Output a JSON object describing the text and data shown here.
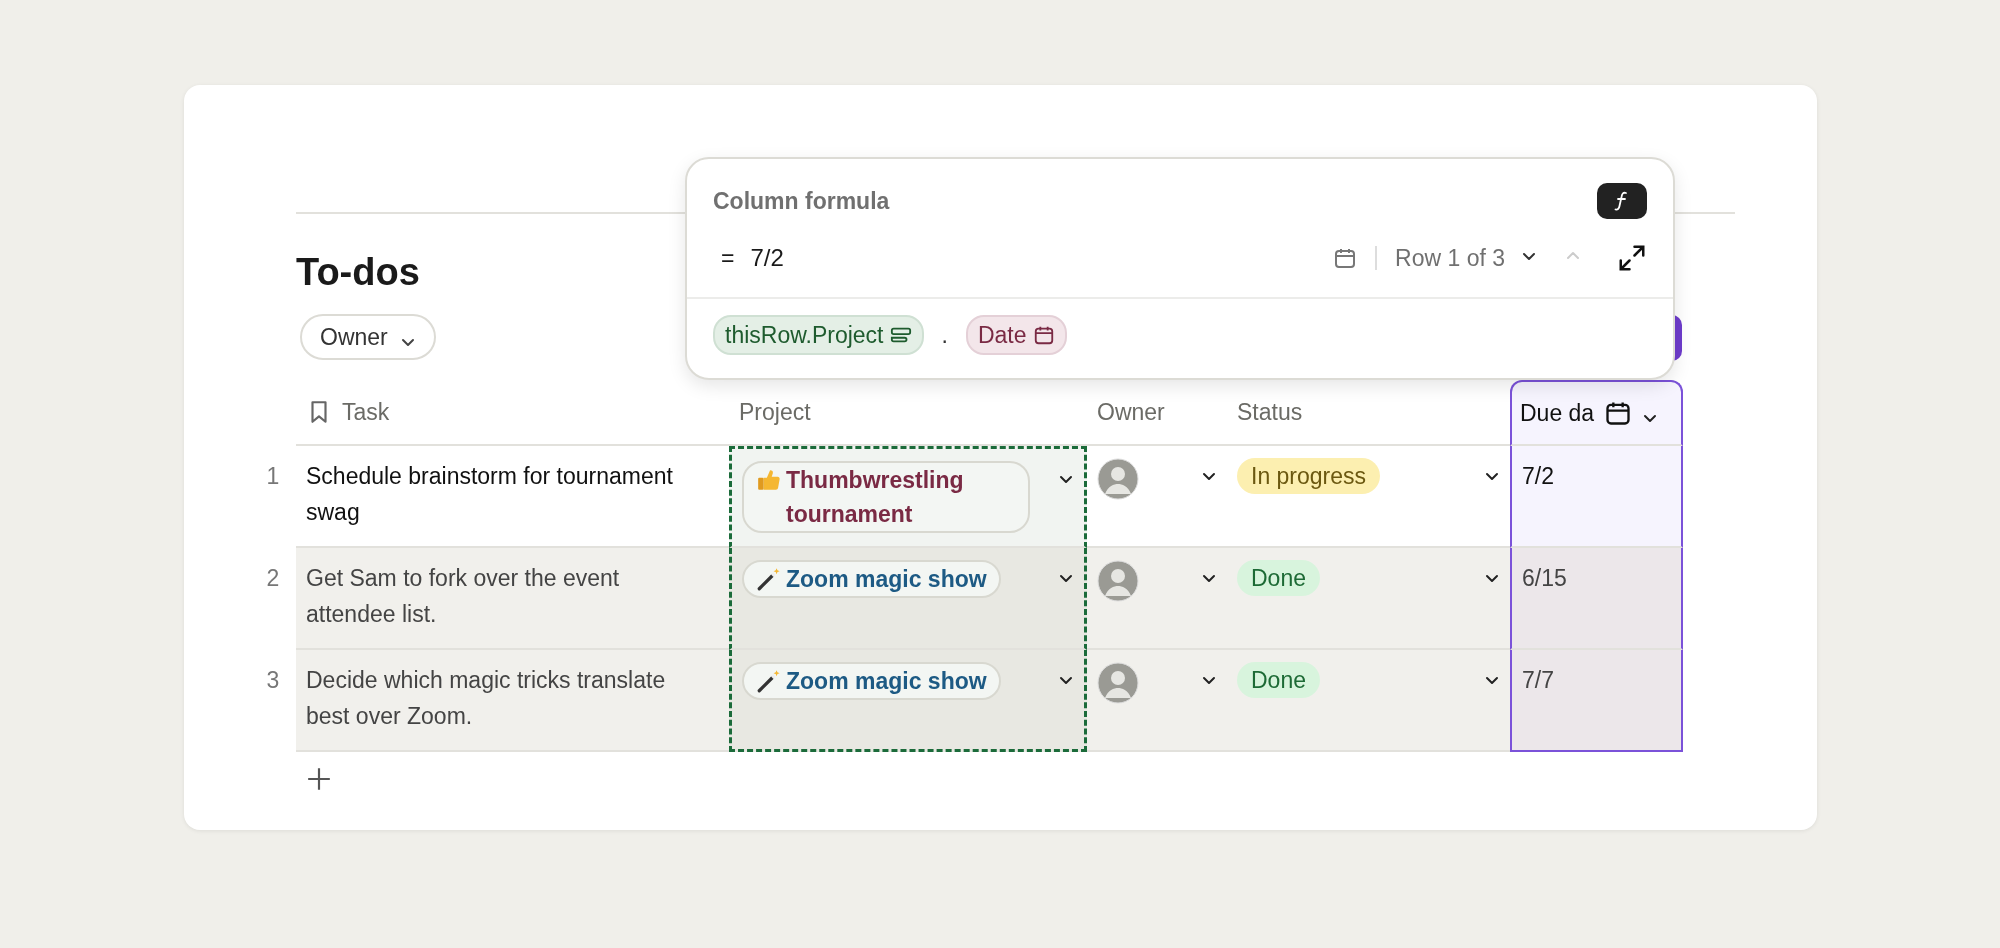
{
  "formula_popup": {
    "title": "Column formula",
    "equals": "=",
    "result": "7/2",
    "row_indicator": "Row 1 of 3",
    "prev_disabled": true,
    "next_disabled": false,
    "tokens": [
      {
        "text": "thisRow.Project",
        "kind": "column"
      },
      {
        "text": ".",
        "kind": "operator"
      },
      {
        "text": "Date",
        "kind": "property"
      }
    ]
  },
  "table": {
    "title": "To-dos",
    "filters": [
      {
        "label": "Owner"
      }
    ],
    "columns": [
      {
        "label": "Task",
        "kind": "text",
        "referenced": false,
        "selected": false
      },
      {
        "label": "Project",
        "kind": "relation",
        "referenced": true,
        "selected": false
      },
      {
        "label": "Owner",
        "kind": "person",
        "referenced": false,
        "selected": false
      },
      {
        "label": "Status",
        "kind": "select",
        "referenced": false,
        "selected": false
      },
      {
        "label": "Due da",
        "kind": "date",
        "referenced": false,
        "selected": true
      }
    ],
    "rows": [
      {
        "number": "1",
        "selected": true,
        "task": "Schedule brainstorm for tournament swag",
        "project": {
          "label": "Thumbwrestling tournament",
          "kind": "thumbs_up",
          "color": "#7a2a44"
        },
        "status": {
          "label": "In progress",
          "kind": "in_progress"
        },
        "due": "7/2"
      },
      {
        "number": "2",
        "selected": false,
        "task": "Get Sam to fork over the event attendee list.",
        "project": {
          "label": "Zoom magic show",
          "kind": "magic_wand",
          "color": "#1d5a84"
        },
        "status": {
          "label": "Done",
          "kind": "done"
        },
        "due": "6/15"
      },
      {
        "number": "3",
        "selected": false,
        "task": "Decide which magic tricks translate best over Zoom.",
        "project": {
          "label": "Zoom magic show",
          "kind": "magic_wand",
          "color": "#1d5a84"
        },
        "status": {
          "label": "Done",
          "kind": "done"
        },
        "due": "7/7"
      }
    ]
  }
}
